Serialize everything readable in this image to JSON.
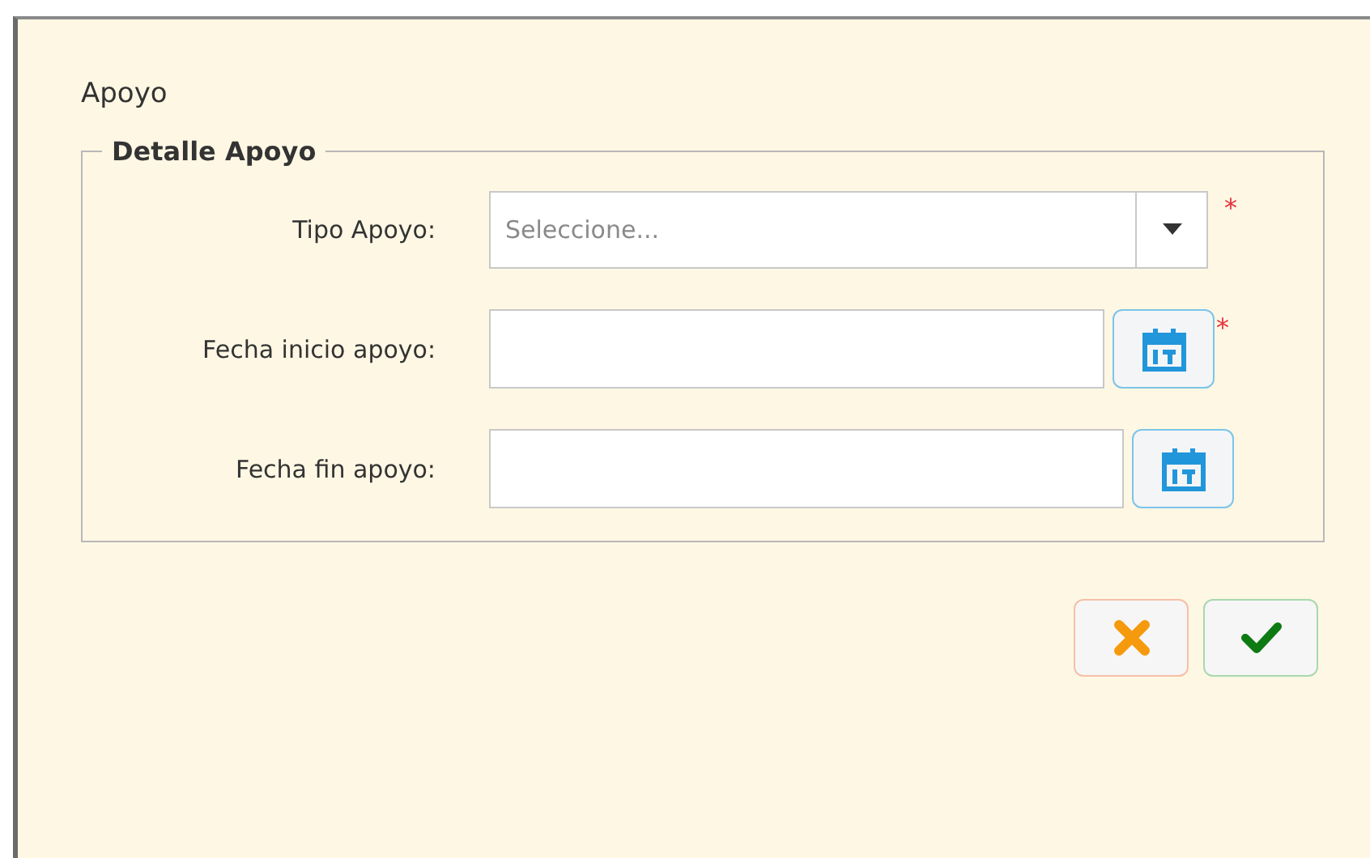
{
  "dialog": {
    "title": "Apoyo"
  },
  "fieldset": {
    "legend": "Detalle Apoyo",
    "fields": [
      {
        "kind": "select",
        "label": "Tipo Apoyo:",
        "placeholder": "Seleccione...",
        "required_mark": "*"
      },
      {
        "kind": "date",
        "label": "Fecha inicio apoyo:",
        "required_mark": "*"
      },
      {
        "kind": "date",
        "label": "Fecha fin apoyo:"
      }
    ]
  },
  "buttons": [
    {
      "kind": "cancel"
    },
    {
      "kind": "confirm"
    }
  ]
}
